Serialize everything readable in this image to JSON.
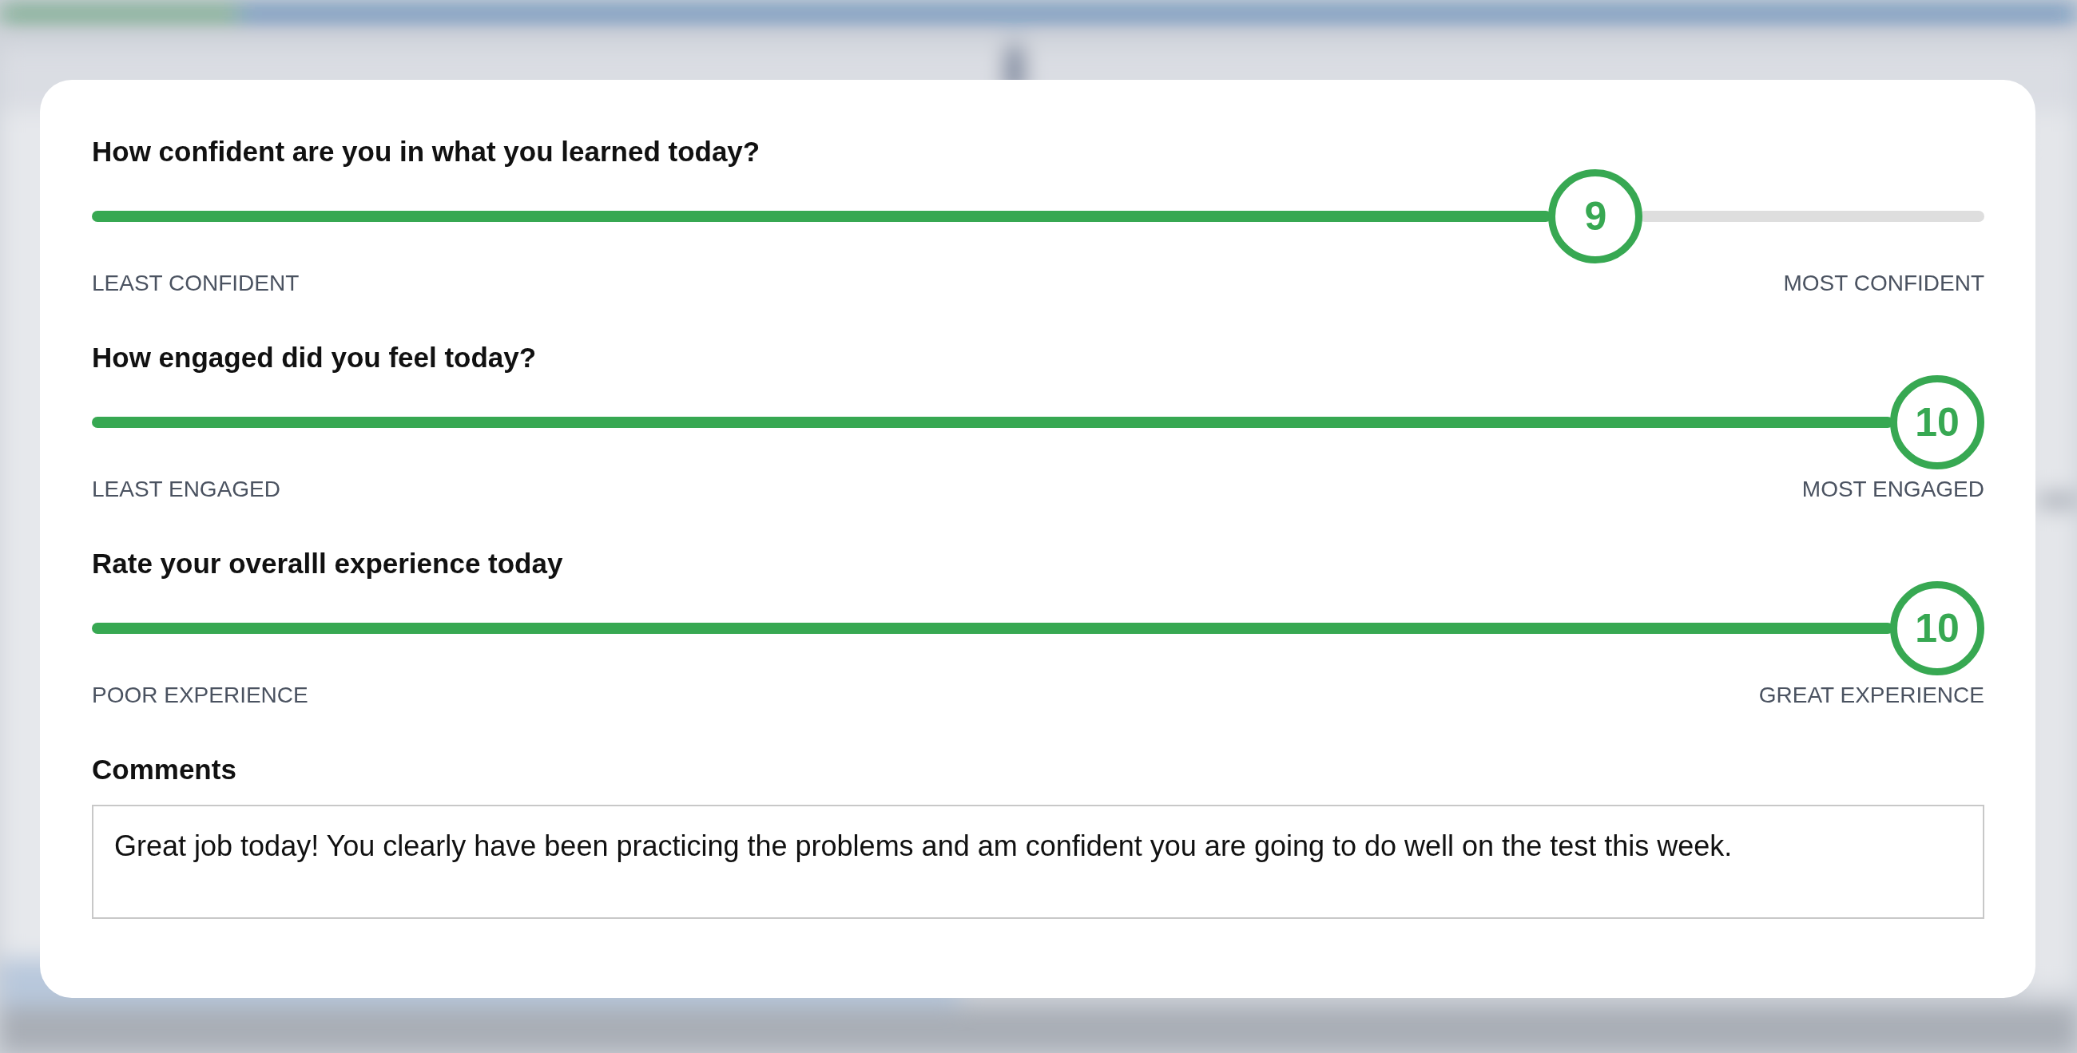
{
  "questions": [
    {
      "question": "How confident are you in what you learned today?",
      "value": "9",
      "level": 0.81,
      "min_label": "LEAST CONFIDENT",
      "max_label": "MOST CONFIDENT"
    },
    {
      "question": "How engaged did you feel today?",
      "value": "10",
      "level": 1,
      "min_label": "LEAST ENGAGED",
      "max_label": "MOST ENGAGED"
    },
    {
      "question": "Rate your overalll experience today",
      "value": "10",
      "level": 1,
      "min_label": "POOR EXPERIENCE",
      "max_label": "GREAT EXPERIENCE"
    }
  ],
  "comments": {
    "label": "Comments",
    "value": "Great job today! You clearly have been practicing the problems and am confident you are going to do well on the test this week."
  }
}
